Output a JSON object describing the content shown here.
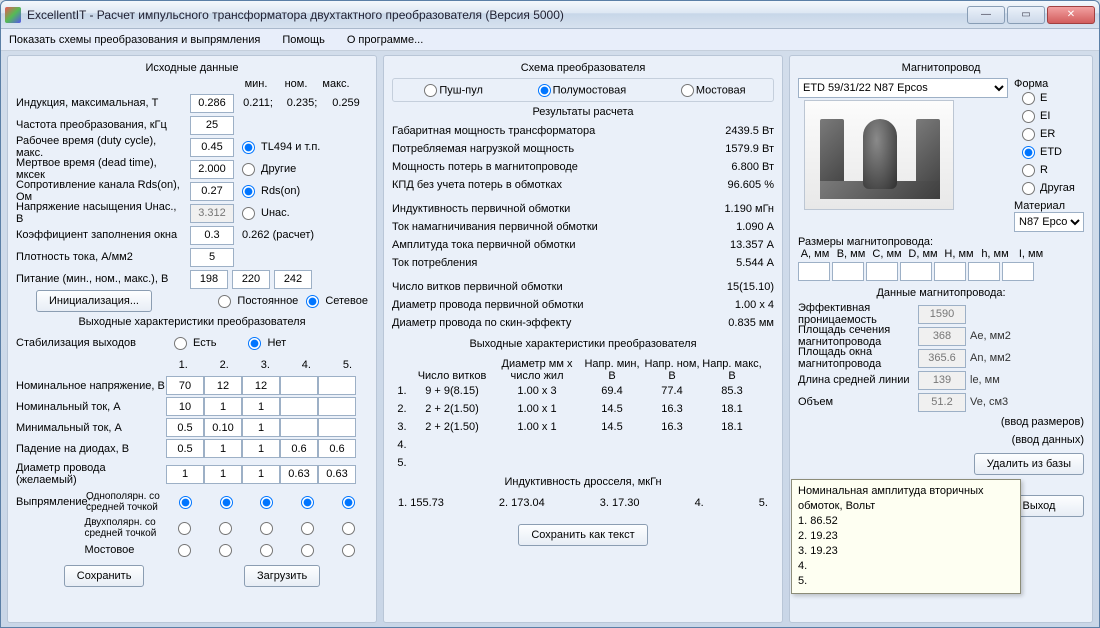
{
  "window": {
    "title": "ExcellentIT - Расчет импульсного трансформатора двухтактного преобразователя (Версия 5000)"
  },
  "menu": {
    "schemes": "Показать схемы преобразования и выпрямления",
    "help": "Помощь",
    "about": "О программе..."
  },
  "input": {
    "title": "Исходные данные",
    "cols": {
      "min": "мин.",
      "nom": "ном.",
      "max": "макс."
    },
    "induction_lbl": "Индукция, максимальная, Т",
    "induction": "0.286",
    "ind_min": "0.211;",
    "ind_nom": "0.235;",
    "ind_max": "0.259",
    "freq_lbl": "Частота преобразования, кГц",
    "freq": "25",
    "duty_lbl": "Рабочее время (duty cycle), макс.",
    "duty": "0.45",
    "tl494": "TL494 и т.п.",
    "dead_lbl": "Мертвое время (dead time), мксек",
    "dead": "2.000",
    "other": "Другие",
    "rds_lbl": "Сопротивление канала Rds(on), Ом",
    "rds": "0.27",
    "rds_radio": "Rds(on)",
    "usat_lbl": "Напряжение насыщения Uнас., В",
    "usat": "3.312",
    "usat_radio": "Uнас.",
    "fill_lbl": "Коэффициент заполнения окна",
    "fill": "0.3",
    "fill_calc": "0.262 (расчет)",
    "jdens_lbl": "Плотность тока, А/мм2",
    "jdens": "5",
    "supply_lbl": "Питание (мин., ном., макс.), В",
    "supply_min": "198",
    "supply_nom": "220",
    "supply_max": "242",
    "init_btn": "Инициализация...",
    "dc": "Постоянное",
    "ac": "Сетевое"
  },
  "output": {
    "title": "Выходные характеристики преобразователя",
    "stab_lbl": "Стабилизация выходов",
    "stab_yes": "Есть",
    "stab_no": "Нет",
    "cols": [
      "1.",
      "2.",
      "3.",
      "4.",
      "5."
    ],
    "vnom_lbl": "Номинальное напряжение, В",
    "vnom": [
      "70",
      "12",
      "12",
      "",
      ""
    ],
    "inom_lbl": "Номинальный ток, А",
    "inom": [
      "10",
      "1",
      "1",
      "",
      ""
    ],
    "imin_lbl": "Минимальный ток, А",
    "imin": [
      "0.5",
      "0.10",
      "1",
      "",
      ""
    ],
    "vdiode_lbl": "Падение на диодах, В",
    "vdiode": [
      "0.5",
      "1",
      "1",
      "0.6",
      "0.6"
    ],
    "dwire_lbl": "Диаметр провода\n(желаемый)",
    "dwire": [
      "1",
      "1",
      "1",
      "0.63",
      "0.63"
    ],
    "rect_lbl": "Выпрямление:",
    "rect1": "Однополярн. со средней точкой",
    "rect2": "Двухполярн. со средней точкой",
    "rect3": "Мостовое",
    "save": "Сохранить",
    "load": "Загрузить"
  },
  "scheme": {
    "title": "Схема преобразователя",
    "push": "Пуш-пул",
    "half": "Полумостовая",
    "full": "Мостовая"
  },
  "results": {
    "title": "Результаты расчета",
    "r1l": "Габаритная мощность трансформатора",
    "r1v": "2439.5 Вт",
    "r2l": "Потребляемая нагрузкой мощность",
    "r2v": "1579.9 Вт",
    "r3l": "Мощность потерь в магнитопроводе",
    "r3v": "6.800 Вт",
    "r4l": "КПД без учета потерь в обмотках",
    "r4v": "96.605 %",
    "r5l": "Индуктивность первичной обмотки",
    "r5v": "1.190 мГн",
    "r6l": "Ток намагничивания первичной обмотки",
    "r6v": "1.090 А",
    "r7l": "Амплитуда тока первичной обмотки",
    "r7v": "13.357 А",
    "r8l": "Ток потребления",
    "r8v": "5.544 А",
    "r9l": "Число витков первичной обмотки",
    "r9v": "15(15.10)",
    "r10l": "Диаметр провода первичной обмотки",
    "r10v": "1.00 x 4",
    "r11l": "Диаметр провода по скин-эффекту",
    "r11v": "0.835 мм",
    "sec_title": "Выходные характеристики преобразователя",
    "hdr": [
      "",
      "Число витков",
      "Диаметр мм x число жил",
      "Напр. мин, В",
      "Напр. ном, В",
      "Напр. макс, В"
    ],
    "rows": [
      [
        "1.",
        "9 + 9(8.15)",
        "1.00 x 3",
        "69.4",
        "77.4",
        "85.3"
      ],
      [
        "2.",
        "2 + 2(1.50)",
        "1.00 x 1",
        "14.5",
        "16.3",
        "18.1"
      ],
      [
        "3.",
        "2 + 2(1.50)",
        "1.00 x 1",
        "14.5",
        "16.3",
        "18.1"
      ],
      [
        "4.",
        "",
        "",
        "",
        "",
        ""
      ],
      [
        "5.",
        "",
        "",
        "",
        "",
        ""
      ]
    ],
    "ind_title": "Индуктивность дросселя, мкГн",
    "ind_row": [
      "1. 155.73",
      "2. 173.04",
      "3. 17.30",
      "4.",
      "5."
    ],
    "save_txt": "Сохранить как текст"
  },
  "core": {
    "title": "Магнитопровод",
    "select": "ETD 59/31/22 N87 Epcos",
    "form_lbl": "Форма",
    "forms": [
      "E",
      "EI",
      "ER",
      "ETD",
      "R",
      "Другая"
    ],
    "mat_lbl": "Материал",
    "mat": "N87 Epcos",
    "dims_lbl": "Размеры магнитопровода:",
    "dims_hdr": [
      "A, мм",
      "B, мм",
      "C, мм",
      "D, мм",
      "H, мм",
      "h, мм",
      "I, мм"
    ],
    "data_lbl": "Данные магнитопровода:",
    "mu_lbl": "Эффективная проницаемость",
    "mu": "1590",
    "ae_lbl": "Площадь сечения магнитопровода",
    "ae": "368",
    "ae_u": "Ae, мм2",
    "an_lbl": "Площадь окна магнитопровода",
    "an": "365.6",
    "an_u": "An, мм2",
    "le_lbl": "Длина средней линии",
    "le": "139",
    "le_u": "le, мм",
    "ve_lbl": "Объем",
    "ve": "51.2",
    "ve_u": "Ve, см3",
    "calc1": "(ввод размеров)",
    "calc2": "(ввод данных)",
    "del_btn": "Удалить из базы",
    "exit": "Выход"
  },
  "tooltip": {
    "title": "Номинальная амплитуда вторичных обмоток, Вольт",
    "lines": [
      "1. 86.52",
      "2. 19.23",
      "3. 19.23",
      "4.",
      "5."
    ]
  }
}
